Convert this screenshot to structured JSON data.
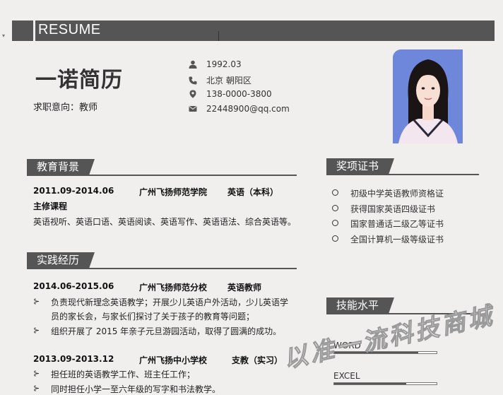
{
  "header": {
    "title": "RESUME"
  },
  "profile": {
    "name": "一诺简历",
    "objective": "求职意向：教师",
    "birth": "1992.03",
    "location": "北京 朝阳区",
    "phone": "138-0000-3800",
    "email": "22448900@qq.com"
  },
  "education": {
    "title": "教育背景",
    "period": "2011.09-2014.06",
    "school": "广州飞扬师范学院",
    "major": "英语（本科）",
    "courses_label": "主修课程",
    "courses": "英语视听、英语口语、英语阅读、英语写作、英语语法、综合英语等。"
  },
  "practice": {
    "title": "实践经历",
    "items": [
      {
        "period": "2014.06-2015.06",
        "org": "广州飞扬师范分校",
        "role": "英语教师",
        "bullets": [
          "负责现代新理念英语教学；开展少儿英语户外活动，少儿英语学",
          "员的家长会，与家长们探讨了关于孩子的教育等问题；",
          "组织开展了 2015 年亲子元旦游园活动，取得了圆满的成功。"
        ]
      },
      {
        "period": "2013.09-2013.12",
        "org": "广州飞扬中小学校",
        "role": "支教（实习）",
        "bullets": [
          "担任班的英语教学工作、班主任工作；",
          "同时担任小学一至六年级的写字和书法教学。"
        ]
      }
    ]
  },
  "awards": {
    "title": "奖项证书",
    "items": [
      "初级中学英语教师资格证",
      "获得国家英语四级证书",
      "国家普通话二级乙等证书",
      "全国计算机一级等级证书"
    ]
  },
  "skills": {
    "title": "技能水平",
    "items": [
      {
        "name": "WORD",
        "level": 0.82
      },
      {
        "name": "EXCEL",
        "level": 0.7
      }
    ]
  },
  "watermark": "以准一流科技商城",
  "icons": [
    "user-icon",
    "phone-icon",
    "location-icon",
    "email-icon"
  ]
}
